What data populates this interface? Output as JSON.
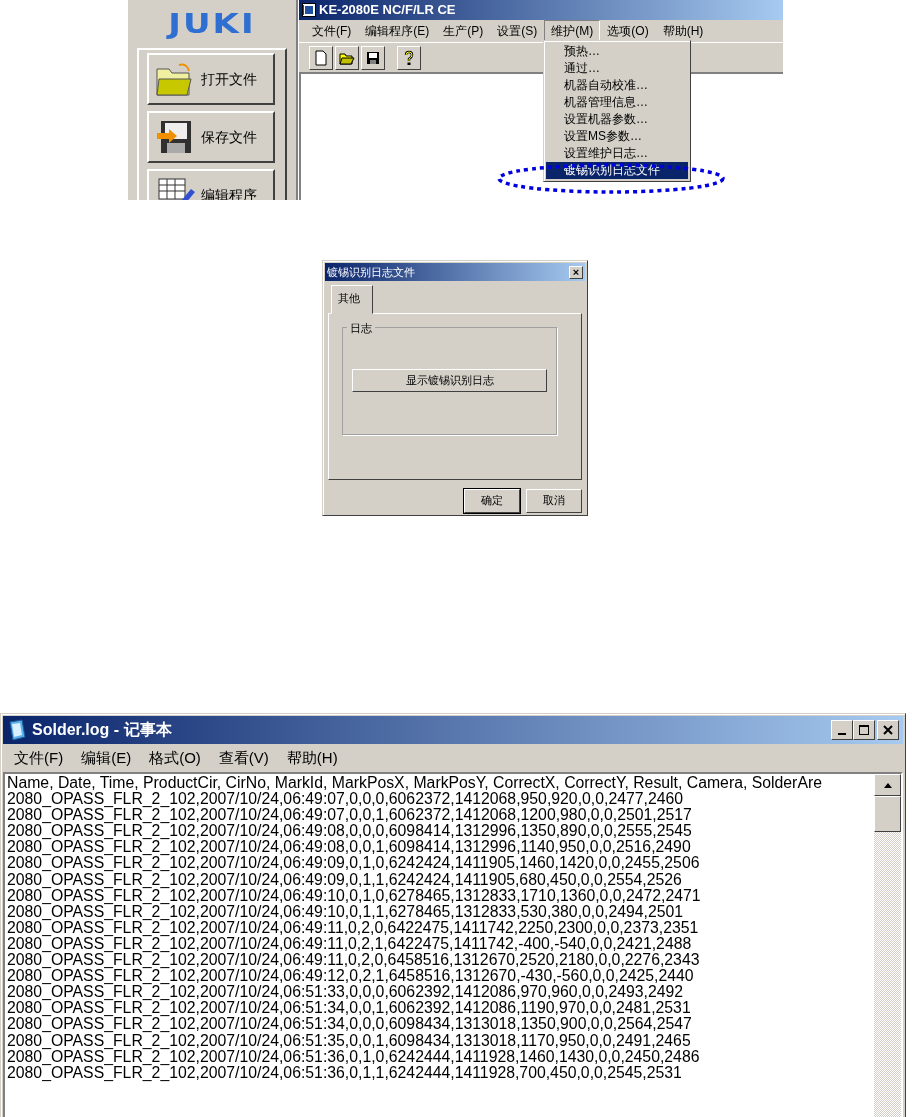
{
  "app_window": {
    "logo": "JUKI",
    "side_buttons": [
      {
        "label": "打开文件",
        "kind": "folder"
      },
      {
        "label": "保存文件",
        "kind": "disk"
      },
      {
        "label": "编辑程序",
        "kind": "grid"
      }
    ],
    "title": "KE-2080E NC/F/LR CE",
    "menu": [
      {
        "label": "文件(F)",
        "open": false
      },
      {
        "label": "编辑程序(E)",
        "open": false
      },
      {
        "label": "生产(P)",
        "open": false
      },
      {
        "label": "设置(S)",
        "open": false
      },
      {
        "label": "维护(M)",
        "open": true
      },
      {
        "label": "选项(O)",
        "open": false
      },
      {
        "label": "帮助(H)",
        "open": false
      }
    ],
    "toolbar": [
      {
        "kind": "new"
      },
      {
        "kind": "open"
      },
      {
        "kind": "save"
      },
      {
        "kind": "help"
      }
    ],
    "dropdown": [
      {
        "label": "预热…",
        "selected": false
      },
      {
        "label": "通过…",
        "selected": false
      },
      {
        "label": "机器自动校准…",
        "selected": false
      },
      {
        "label": "机器管理信息…",
        "selected": false
      },
      {
        "label": "设置机器参数…",
        "selected": false
      },
      {
        "label": "设置MS参数…",
        "selected": false
      },
      {
        "label": "设置维护日志…",
        "selected": false
      },
      {
        "label": "镀锡识别日志文件",
        "selected": true,
        "circled": true
      }
    ]
  },
  "dialog": {
    "title": "镀锡识别日志文件",
    "close": "×",
    "tabs": [
      {
        "label": "其他",
        "selected": true
      }
    ],
    "group": "日志",
    "action_button": "显示镀锡识别日志",
    "buttons": [
      "确定",
      "取消"
    ]
  },
  "notepad": {
    "title": "Solder.log - 记事本",
    "menu": [
      "文件(F)",
      "编辑(E)",
      "格式(O)",
      "查看(V)",
      "帮助(H)"
    ],
    "lines": [
      "Name, Date, Time, ProductCir, CirNo, MarkId, MarkPosX, MarkPosY, CorrectX, CorrectY, Result, Camera, SolderAre",
      "2080_OPASS_FLR_2_102,2007/10/24,06:49:07,0,0,0,6062372,1412068,950,920,0,0,2477,2460",
      "2080_OPASS_FLR_2_102,2007/10/24,06:49:07,0,0,1,6062372,1412068,1200,980,0,0,2501,2517",
      "2080_OPASS_FLR_2_102,2007/10/24,06:49:08,0,0,0,6098414,1312996,1350,890,0,0,2555,2545",
      "2080_OPASS_FLR_2_102,2007/10/24,06:49:08,0,0,1,6098414,1312996,1140,950,0,0,2516,2490",
      "2080_OPASS_FLR_2_102,2007/10/24,06:49:09,0,1,0,6242424,1411905,1460,1420,0,0,2455,2506",
      "2080_OPASS_FLR_2_102,2007/10/24,06:49:09,0,1,1,6242424,1411905,680,450,0,0,2554,2526",
      "2080_OPASS_FLR_2_102,2007/10/24,06:49:10,0,1,0,6278465,1312833,1710,1360,0,0,2472,2471",
      "2080_OPASS_FLR_2_102,2007/10/24,06:49:10,0,1,1,6278465,1312833,530,380,0,0,2494,2501",
      "2080_OPASS_FLR_2_102,2007/10/24,06:49:11,0,2,0,6422475,1411742,2250,2300,0,0,2373,2351",
      "2080_OPASS_FLR_2_102,2007/10/24,06:49:11,0,2,1,6422475,1411742,-400,-540,0,0,2421,2488",
      "2080_OPASS_FLR_2_102,2007/10/24,06:49:11,0,2,0,6458516,1312670,2520,2180,0,0,2276,2343",
      "2080_OPASS_FLR_2_102,2007/10/24,06:49:12,0,2,1,6458516,1312670,-430,-560,0,0,2425,2440",
      "2080_OPASS_FLR_2_102,2007/10/24,06:51:33,0,0,0,6062392,1412086,970,960,0,0,2493,2492",
      "2080_OPASS_FLR_2_102,2007/10/24,06:51:34,0,0,1,6062392,1412086,1190,970,0,0,2481,2531",
      "2080_OPASS_FLR_2_102,2007/10/24,06:51:34,0,0,0,6098434,1313018,1350,900,0,0,2564,2547",
      "2080_OPASS_FLR_2_102,2007/10/24,06:51:35,0,0,1,6098434,1313018,1170,950,0,0,2491,2465",
      "2080_OPASS_FLR_2_102,2007/10/24,06:51:36,0,1,0,6242444,1411928,1460,1430,0,0,2450,2486",
      "2080_OPASS_FLR_2_102,2007/10/24,06:51:36,0,1,1,6242444,1411928,700,450,0,0,2545,2531"
    ]
  }
}
